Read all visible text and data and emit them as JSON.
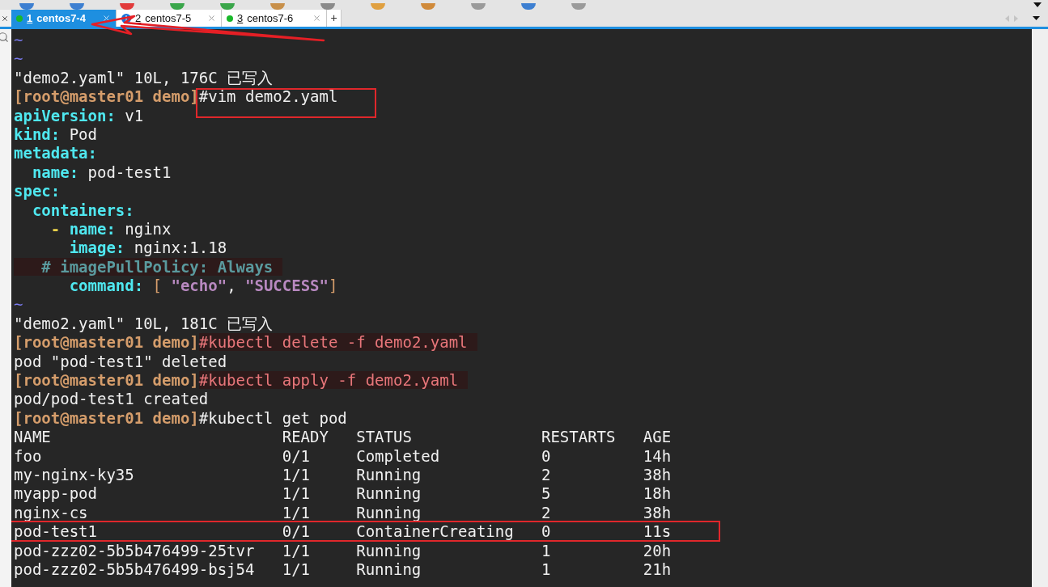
{
  "tabs": [
    {
      "number": "1",
      "name": "centos7-4",
      "selected": true,
      "kind": "dot"
    },
    {
      "number": "2",
      "name": "centos7-5",
      "selected": false,
      "kind": "info"
    },
    {
      "number": "3",
      "name": "centos7-6",
      "selected": false,
      "kind": "dot"
    }
  ],
  "new_tab": "+",
  "terminal_lines": [
    {
      "segments": [
        {
          "text": "~",
          "kind": "tilde"
        }
      ]
    },
    {
      "segments": [
        {
          "text": "~",
          "kind": "tilde"
        }
      ]
    },
    {
      "segments": [
        {
          "text": "\"demo2.yaml\" 10L, 176C 已写入",
          "kind": "plain"
        }
      ]
    },
    {
      "segments": [
        {
          "text": "[root@master01 demo]",
          "kind": "prompt"
        },
        {
          "text": "#vim demo2.yaml",
          "kind": "plain",
          "marked": true
        }
      ]
    },
    {
      "segments": [
        {
          "text": "apiVersion:",
          "kind": "key"
        },
        {
          "text": " v1",
          "kind": "plain"
        }
      ]
    },
    {
      "segments": [
        {
          "text": "kind:",
          "kind": "key"
        },
        {
          "text": " Pod",
          "kind": "plain"
        }
      ]
    },
    {
      "segments": [
        {
          "text": "metadata:",
          "kind": "key"
        }
      ]
    },
    {
      "segments": [
        {
          "text": "  name:",
          "kind": "key"
        },
        {
          "text": " pod-test1",
          "kind": "plain"
        }
      ]
    },
    {
      "segments": [
        {
          "text": "spec:",
          "kind": "key"
        }
      ]
    },
    {
      "segments": [
        {
          "text": "  containers:",
          "kind": "key"
        }
      ]
    },
    {
      "segments": [
        {
          "text": "    -",
          "kind": "dash"
        },
        {
          "text": " name:",
          "kind": "key"
        },
        {
          "text": " nginx",
          "kind": "plain"
        }
      ]
    },
    {
      "segments": [
        {
          "text": "      image:",
          "kind": "key"
        },
        {
          "text": " nginx:1.18",
          "kind": "plain"
        }
      ]
    },
    {
      "segments": [
        {
          "text": "   # imagePullPolicy: Always",
          "kind": "comment",
          "shaded": true
        }
      ]
    },
    {
      "segments": [
        {
          "text": "      command:",
          "kind": "key"
        },
        {
          "text": " [ ",
          "kind": "bracket"
        },
        {
          "text": "\"echo\"",
          "kind": "string"
        },
        {
          "text": ", ",
          "kind": "plain"
        },
        {
          "text": "\"SUCCESS\"",
          "kind": "string"
        },
        {
          "text": "]",
          "kind": "bracket"
        }
      ]
    },
    {
      "segments": [
        {
          "text": "~",
          "kind": "tilde"
        }
      ]
    },
    {
      "segments": [
        {
          "text": "\"demo2.yaml\" 10L, 181C 已写入",
          "kind": "plain"
        }
      ]
    },
    {
      "segments": [
        {
          "text": "[root@master01 demo]",
          "kind": "prompt"
        },
        {
          "text": "#kubectl delete -f demo2.yaml",
          "kind": "command",
          "shaded": true
        }
      ]
    },
    {
      "segments": [
        {
          "text": "pod \"pod-test1\" deleted",
          "kind": "plain"
        }
      ]
    },
    {
      "segments": [
        {
          "text": "[root@master01 demo]",
          "kind": "prompt"
        },
        {
          "text": "#kubectl apply -f demo2.yaml",
          "kind": "command",
          "shaded": true
        }
      ]
    },
    {
      "segments": [
        {
          "text": "pod/pod-test1 created",
          "kind": "plain"
        }
      ]
    },
    {
      "segments": [
        {
          "text": "[root@master01 demo]",
          "kind": "prompt"
        },
        {
          "text": "#kubectl get pod",
          "kind": "plain"
        }
      ]
    }
  ],
  "pods_table": {
    "columns": [
      "NAME",
      "READY",
      "STATUS",
      "RESTARTS",
      "AGE"
    ],
    "rows": [
      {
        "cells": [
          "foo",
          "0/1",
          "Completed",
          "0",
          "14h"
        ],
        "marked": false
      },
      {
        "cells": [
          "my-nginx-ky35",
          "1/1",
          "Running",
          "2",
          "38h"
        ],
        "marked": false
      },
      {
        "cells": [
          "myapp-pod",
          "1/1",
          "Running",
          "5",
          "18h"
        ],
        "marked": false
      },
      {
        "cells": [
          "nginx-cs",
          "1/1",
          "Running",
          "2",
          "38h"
        ],
        "marked": false
      },
      {
        "cells": [
          "pod-test1",
          "0/1",
          "ContainerCreating",
          "0",
          "11s"
        ],
        "marked": true
      },
      {
        "cells": [
          "pod-zzz02-5b5b476499-25tvr",
          "1/1",
          "Running",
          "1",
          "20h"
        ],
        "marked": false
      },
      {
        "cells": [
          "pod-zzz02-5b5b476499-bsj54",
          "1/1",
          "Running",
          "1",
          "21h"
        ],
        "marked": false
      }
    ]
  }
}
